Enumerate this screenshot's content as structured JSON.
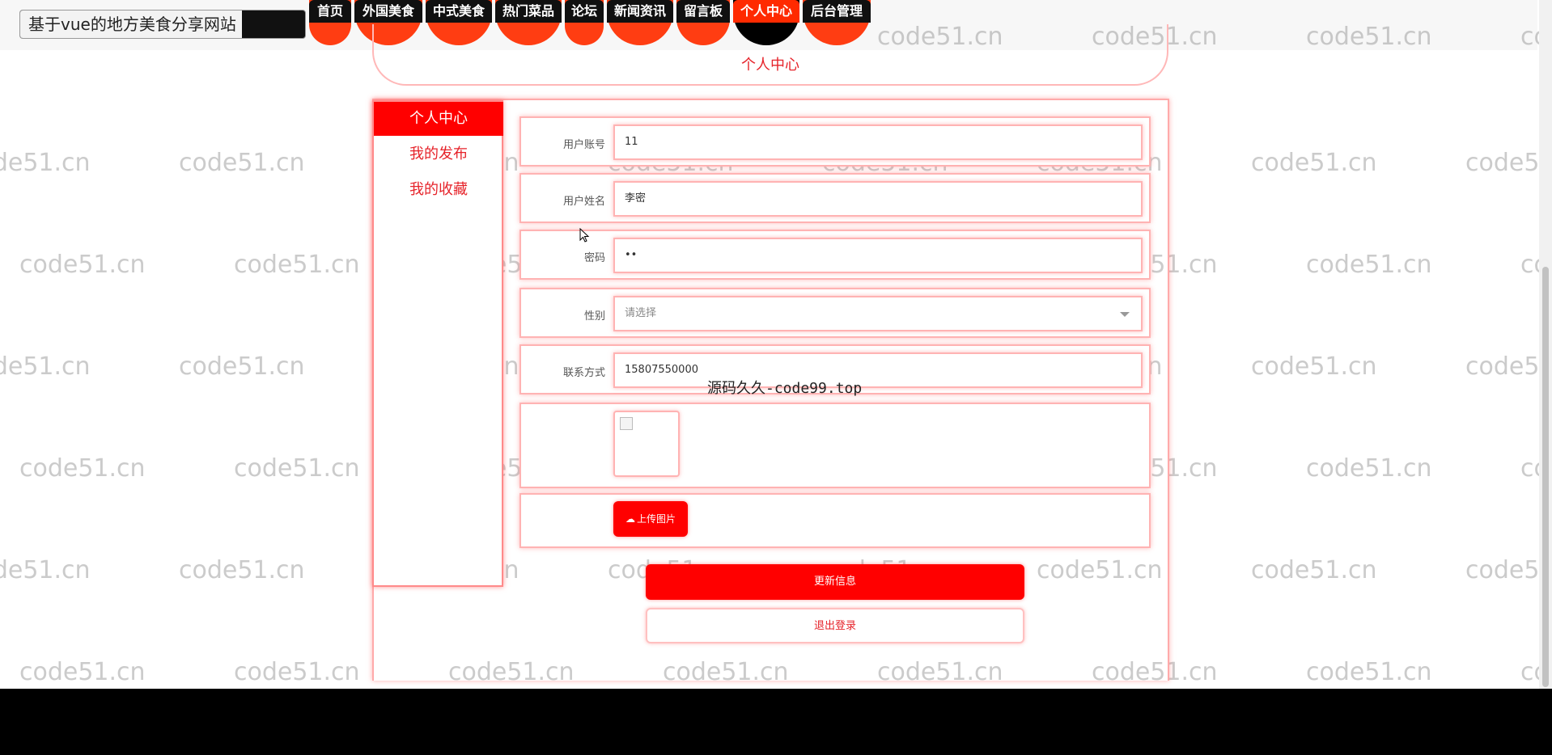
{
  "site": {
    "title": "基于vue的地方美食分享网站"
  },
  "nav": {
    "items": [
      {
        "label": "首页",
        "active": false
      },
      {
        "label": "外国美食",
        "active": false
      },
      {
        "label": "中式美食",
        "active": false
      },
      {
        "label": "热门菜品",
        "active": false
      },
      {
        "label": "论坛",
        "active": false
      },
      {
        "label": "新闻资讯",
        "active": false
      },
      {
        "label": "留言板",
        "active": false
      },
      {
        "label": "个人中心",
        "active": true
      },
      {
        "label": "后台管理",
        "active": false
      }
    ]
  },
  "page_title": "个人中心",
  "sidebar": {
    "items": [
      {
        "label": "个人中心",
        "active": true
      },
      {
        "label": "我的发布",
        "active": false
      },
      {
        "label": "我的收藏",
        "active": false
      }
    ]
  },
  "form": {
    "account": {
      "label": "用户账号",
      "value": "11"
    },
    "name": {
      "label": "用户姓名",
      "value": "李密"
    },
    "password": {
      "label": "密码",
      "value": "••"
    },
    "gender": {
      "label": "性别",
      "placeholder": "请选择"
    },
    "contact": {
      "label": "联系方式",
      "value": "15807550000"
    },
    "upload_label": "上传图片"
  },
  "buttons": {
    "update": "更新信息",
    "logout": "退出登录"
  },
  "watermark": "code51.cn",
  "overlay_text": "源码久久-code99.top",
  "colors": {
    "accent": "#ff0000",
    "nav_cap": "#ff3d12",
    "text_red": "#e6232a"
  }
}
